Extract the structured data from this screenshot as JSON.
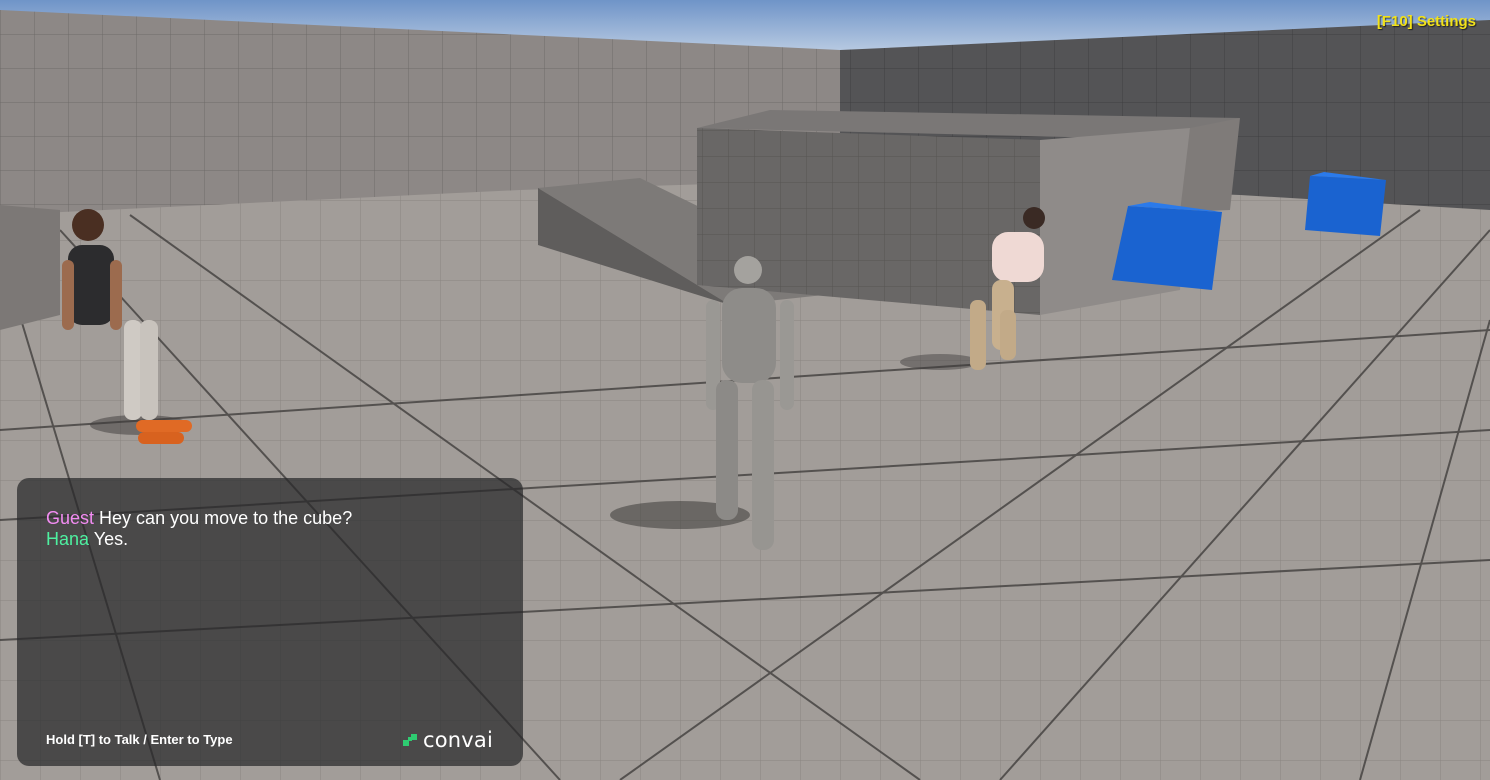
{
  "hud": {
    "settings_label": "[F10] Settings"
  },
  "chat": {
    "messages": [
      {
        "speaker": "Guest",
        "text": "Hey can you move to the cube?"
      },
      {
        "speaker": "Hana",
        "text": " Yes."
      }
    ],
    "hint": "Hold [T] to Talk / Enter to Type",
    "brand": "convai"
  },
  "colors": {
    "settings": "#f2e21a",
    "guest_name": "#f28cf2",
    "hana_name": "#4ef0a0",
    "brand_icon": "#2ecc71",
    "cube": "#1a63d0"
  }
}
